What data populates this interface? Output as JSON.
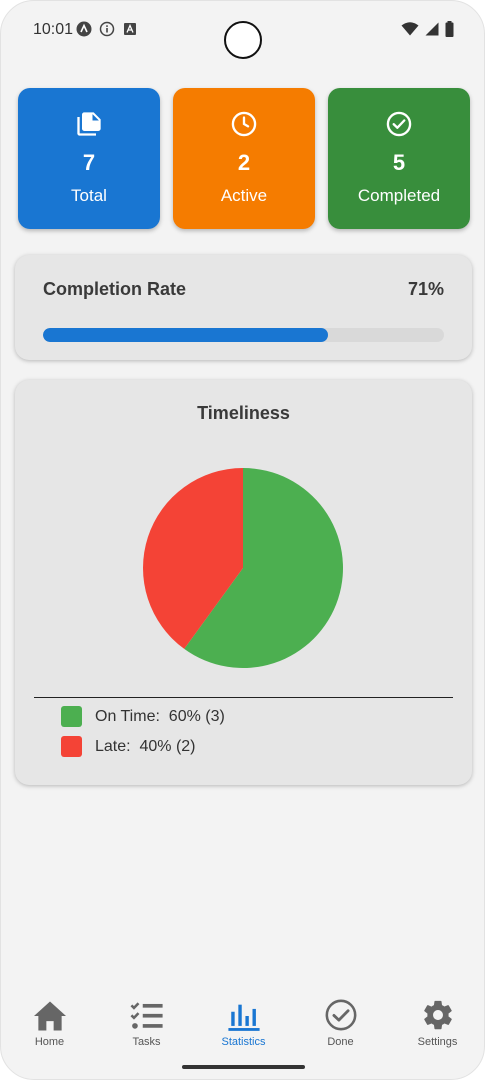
{
  "status_bar": {
    "time": "10:01"
  },
  "stats": {
    "total": {
      "value": "7",
      "label": "Total",
      "color": "#1976d2",
      "icon": "documents-icon"
    },
    "active": {
      "value": "2",
      "label": "Active",
      "color": "#f57c00",
      "icon": "clock-icon"
    },
    "completed": {
      "value": "5",
      "label": "Completed",
      "color": "#388e3c",
      "icon": "check-circle-icon"
    }
  },
  "completion": {
    "title": "Completion Rate",
    "percent_text": "71%",
    "progress": 0.71,
    "bar_color": "#1976d2"
  },
  "timeliness": {
    "title": "Timeliness",
    "legend": [
      {
        "label": "On Time:  60% (3)",
        "color": "#4caf50"
      },
      {
        "label": "Late:  40% (2)",
        "color": "#f44336"
      }
    ]
  },
  "chart_data": {
    "type": "pie",
    "title": "Timeliness",
    "categories": [
      "On Time",
      "Late"
    ],
    "values": [
      3,
      2
    ],
    "percentages": [
      60,
      40
    ],
    "colors": [
      "#4caf50",
      "#f44336"
    ]
  },
  "nav": {
    "items": [
      {
        "label": "Home",
        "icon": "home-icon"
      },
      {
        "label": "Tasks",
        "icon": "checklist-icon"
      },
      {
        "label": "Statistics",
        "icon": "bar-chart-icon",
        "active": true
      },
      {
        "label": "Done",
        "icon": "check-circle-icon"
      },
      {
        "label": "Settings",
        "icon": "gear-icon"
      }
    ],
    "active_color": "#1976d2"
  }
}
